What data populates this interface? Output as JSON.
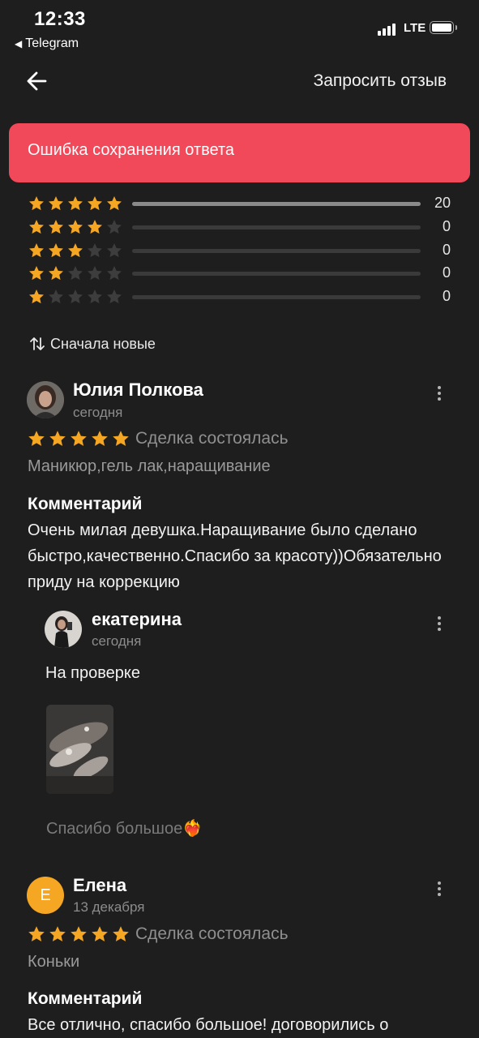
{
  "status_bar": {
    "time": "12:33",
    "back_app": "Telegram",
    "network": "LTE"
  },
  "nav": {
    "request_review": "Запросить отзыв"
  },
  "error_banner": {
    "text": "Ошибка сохранения ответа"
  },
  "rating_summary": [
    {
      "stars": 5,
      "count": "20",
      "fill_fraction": 1.0
    },
    {
      "stars": 4,
      "count": "0",
      "fill_fraction": 0
    },
    {
      "stars": 3,
      "count": "0",
      "fill_fraction": 0
    },
    {
      "stars": 2,
      "count": "0",
      "fill_fraction": 0
    },
    {
      "stars": 1,
      "count": "0",
      "fill_fraction": 0
    }
  ],
  "sort": {
    "label": "Сначала новые"
  },
  "reviews": [
    {
      "author": "Юлия Полкова",
      "date": "сегодня",
      "rating": 5,
      "deal_status": "Сделка состоялась",
      "service": "Маникюр,гель лак,наращивание",
      "comment_title": "Комментарий",
      "comment": "Очень милая девушка.Наращивание было сделано быстро,качественно.Спасибо за красоту))Обязательно приду на коррекцию",
      "reply": {
        "author": "екатерина",
        "date": "сегодня",
        "status": "На проверке",
        "text": "Спасибо большое❤️‍🔥"
      }
    },
    {
      "author": "Елена",
      "avatar_letter": "Е",
      "date": "13 декабря",
      "rating": 5,
      "deal_status": "Сделка состоялась",
      "service": "Коньки",
      "comment_title": "Комментарий",
      "comment": "Все отлично, спасибо большое! договорились о"
    }
  ],
  "colors": {
    "background": "#1e1e1e",
    "error": "#f2495a",
    "star_active": "#f5a623",
    "star_inactive": "#3d3d3d",
    "avatar_letter_bg": "#f5a623"
  },
  "icons": [
    "back-arrow-icon",
    "sort-icon",
    "star-icon",
    "more-vertical-icon",
    "signal-icon",
    "battery-icon"
  ]
}
